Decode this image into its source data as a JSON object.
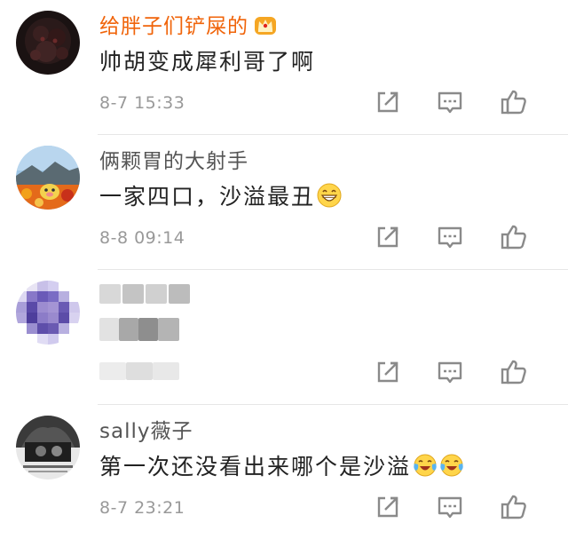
{
  "comments": [
    {
      "username": "给胖子们铲屎的",
      "text": "帅胡变成犀利哥了啊",
      "time": "8-7 15:33",
      "name_color": "#f0640a",
      "badge": "crown-badge-icon"
    },
    {
      "username": "俩颗胃的大射手",
      "text": "一家四口，沙溢最丑",
      "time": "8-8 09:14",
      "name_color": "#555555",
      "emoji": "grin-emoji-icon"
    },
    {
      "username": "",
      "text": "",
      "time": "",
      "blurred": true
    },
    {
      "username": "sally薇子",
      "text": "第一次还没看出来哪个是沙溢",
      "time": "8-7 23:21",
      "name_color": "#555555",
      "emoji": "laugh-cry-emoji-icon"
    }
  ],
  "icons": {
    "share": "share-icon",
    "reply": "comment-icon",
    "like": "thumbs-up-icon"
  },
  "colors": {
    "vip_name": "#f0640a",
    "normal_name": "#555555",
    "text": "#222222",
    "time": "#999999",
    "icon": "#8a8a8a",
    "divider": "#e6e6e6"
  }
}
